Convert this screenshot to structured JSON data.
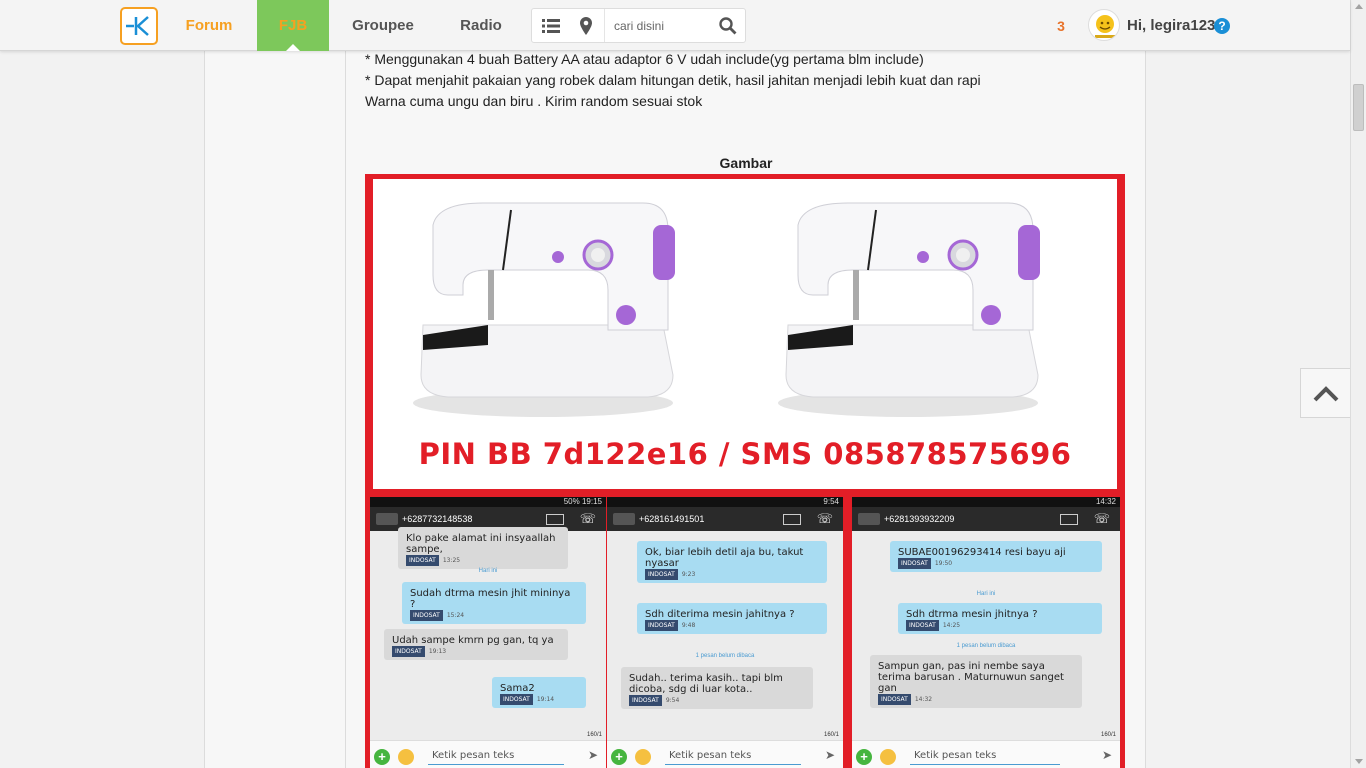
{
  "nav": {
    "forum": "Forum",
    "fjb": "FJB",
    "groupee": "Groupee",
    "radio": "Radio",
    "search_placeholder": "cari disini",
    "notif_count": "3",
    "greeting": "Hi, legira123",
    "help": "?"
  },
  "post": {
    "line1": "* Menggunakan 4 buah Battery AA atau adaptor 6 V udah include(yg pertama blm include)",
    "line2": "* Dapat menjahit pakaian yang robek dalam hitungan detik, hasil jahitan menjadi lebih kuat dan rapi",
    "line3": "Warna cuma ungu dan biru . Kirim random sesuai stok",
    "gambar_title": "Gambar"
  },
  "image": {
    "pin_text": "PIN BB 7d122e16 / SMS 085878575696",
    "phones": [
      {
        "status": "50% 19:15",
        "number": "+6287732148538",
        "msgs": [
          {
            "text": "Klo pake alamat ini insyaallah sampe,",
            "time": "13:25",
            "dir": "in"
          },
          {
            "text": "Sudah dtrma mesin jhit mininya ?",
            "time": "15:24",
            "dir": "out"
          },
          {
            "text": "Udah sampe kmrn pg gan, tq ya",
            "time": "19:13",
            "dir": "in"
          },
          {
            "text": "Sama2",
            "time": "19:14",
            "dir": "out"
          }
        ],
        "separator": "Hari ini",
        "counter": "160/1",
        "input": "Ketik pesan teks"
      },
      {
        "status": "9:54",
        "number": "+628161491501",
        "msgs": [
          {
            "text": "Ok, biar lebih detil aja bu, takut nyasar",
            "time": "9:23",
            "dir": "out"
          },
          {
            "text": "Sdh diterima mesin jahitnya ?",
            "time": "9:48",
            "dir": "out"
          },
          {
            "text": "Sudah.. terima kasih.. tapi blm dicoba, sdg di luar kota..",
            "time": "9:54",
            "dir": "in"
          }
        ],
        "separator": "1 pesan belum dibaca",
        "counter": "160/1",
        "input": "Ketik pesan teks"
      },
      {
        "status": "14:32",
        "number": "+6281393932209",
        "msgs": [
          {
            "text": "SUBAE00196293414 resi bayu aji",
            "time": "19:50",
            "dir": "out"
          },
          {
            "text": "Sdh dtrma mesin jhitnya ?",
            "time": "14:25",
            "dir": "out"
          },
          {
            "text": "Sampun gan, pas ini nembe saya terima barusan . Maturnuwun sanget gan",
            "time": "14:32",
            "dir": "in"
          }
        ],
        "separator": "Hari ini",
        "separator2": "1 pesan belum dibaca",
        "counter": "160/1",
        "input": "Ketik pesan teks"
      }
    ],
    "operator_tag": "INDOSAT"
  },
  "colors": {
    "accent_orange": "#f6a021",
    "fjb_green": "#7dc85b",
    "frame_red": "#e21e27",
    "help_blue": "#1a8fd6"
  }
}
